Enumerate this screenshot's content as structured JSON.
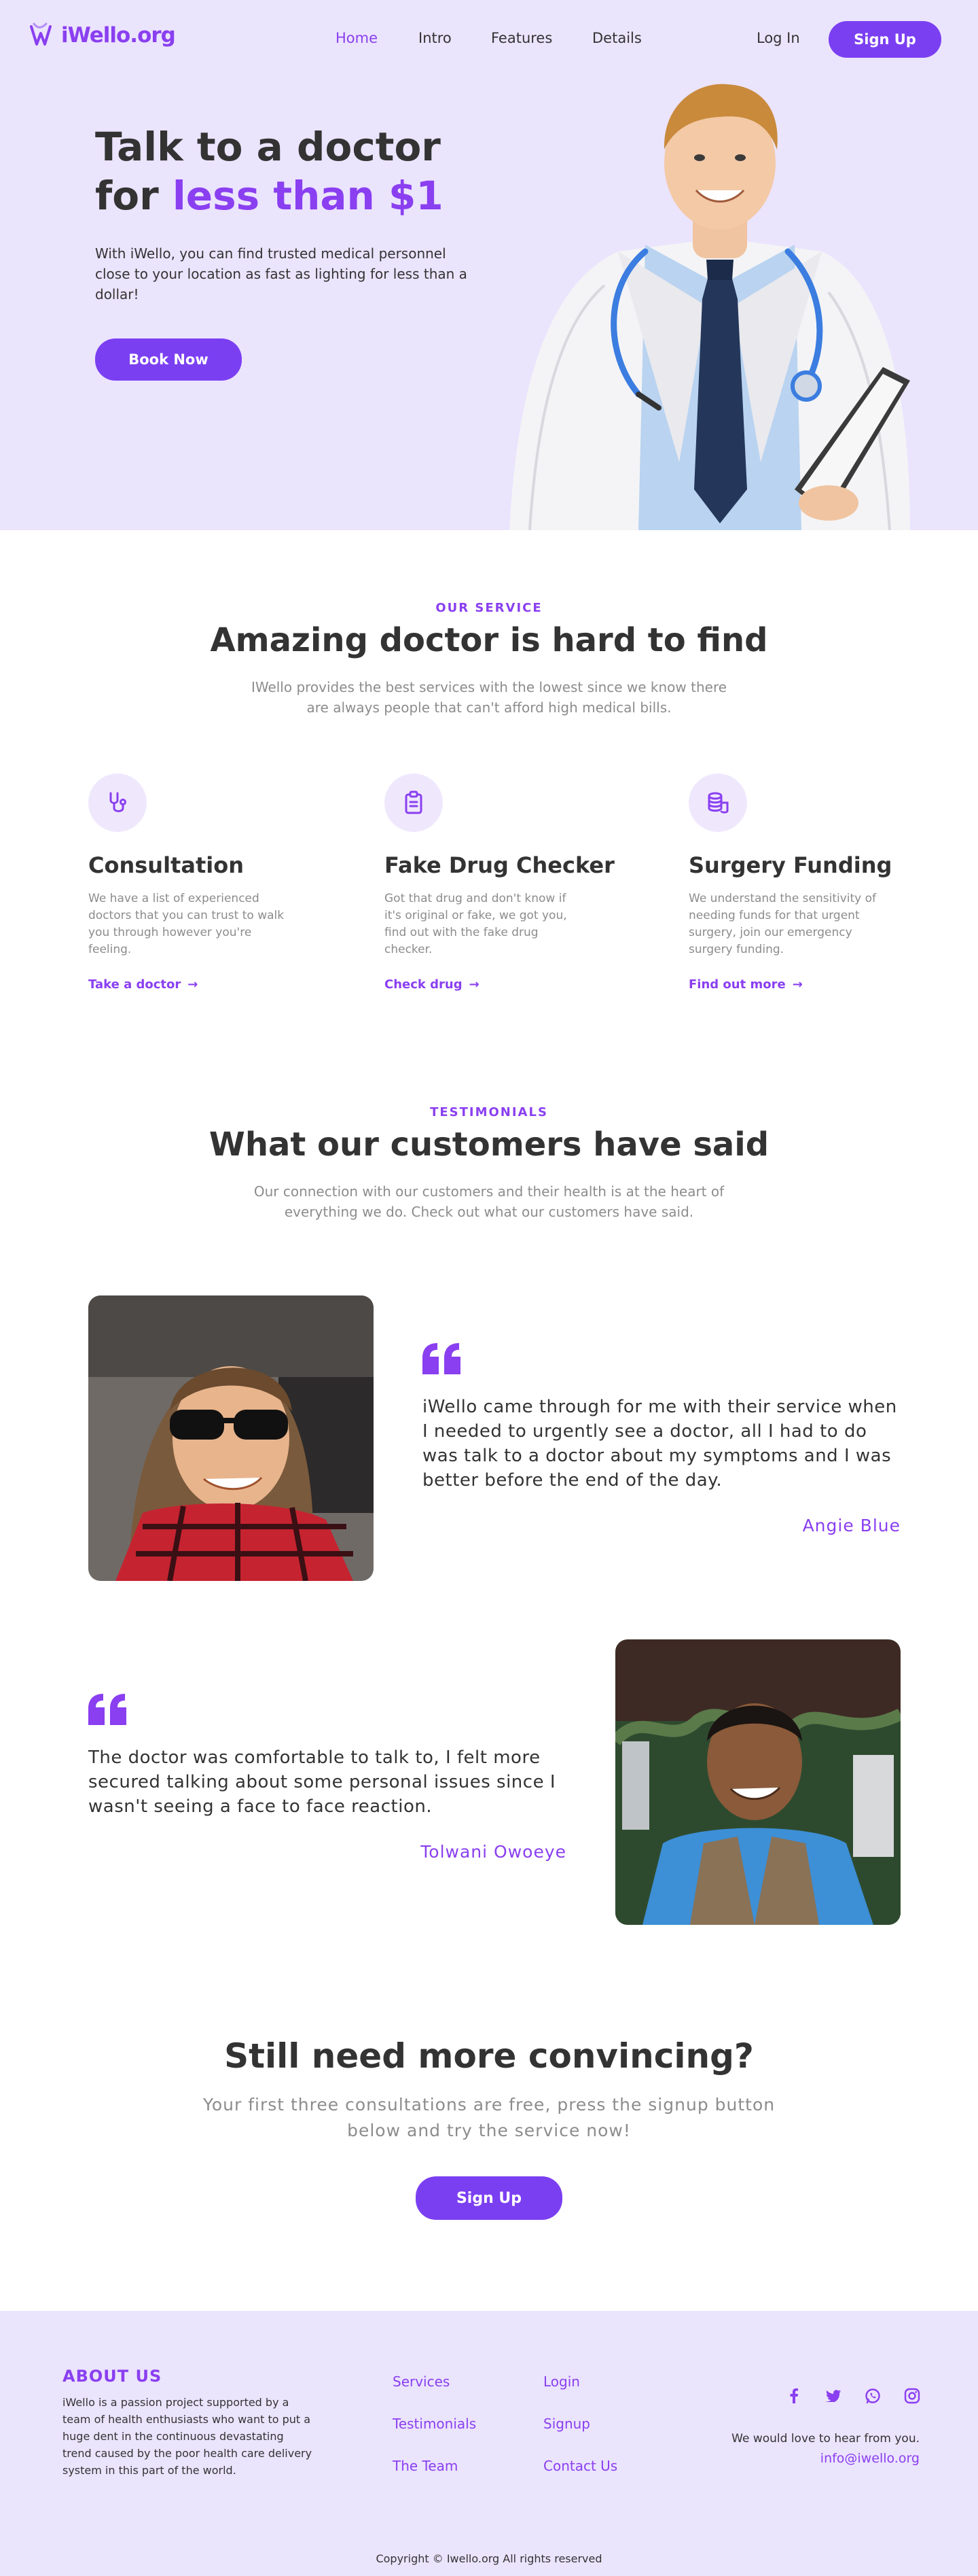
{
  "brand": {
    "logo_text": "iWello.org",
    "accent": "#8a3ff0",
    "button_color": "#7b3ff2",
    "tint": "#ebe4fd"
  },
  "nav": {
    "items": [
      {
        "label": "Home",
        "active": true
      },
      {
        "label": "Intro"
      },
      {
        "label": "Features"
      },
      {
        "label": "Details"
      }
    ],
    "login": "Log In",
    "signup": "Sign Up"
  },
  "hero": {
    "title_line1": "Talk to a doctor",
    "title_line2_prefix": "for ",
    "title_line2_accent": "less than $1",
    "text": "With iWello, you can find trusted medical personnel close to your location as fast as lighting for less than a dollar!",
    "cta": "Book Now"
  },
  "service": {
    "eyebrow": "OUR SERVICE",
    "title": "Amazing doctor is hard to find",
    "subtitle": "IWello provides the best services with the lowest since we know there are always people that can't afford high medical bills.",
    "items": [
      {
        "icon": "stethoscope-icon",
        "title": "Consultation",
        "text": "We have a list of experienced doctors that you can trust to walk you through however you're feeling.",
        "link": "Take a doctor"
      },
      {
        "icon": "clipboard-icon",
        "title": "Fake Drug Checker",
        "text": "Got that drug and don't know if it's original or fake, we got you, find out with the fake drug checker.",
        "link": "Check drug"
      },
      {
        "icon": "coins-icon",
        "title": "Surgery Funding",
        "text": "We understand the sensitivity of needing funds for that urgent surgery, join our emergency surgery funding.",
        "link": "Find out more"
      }
    ]
  },
  "testimonials": {
    "eyebrow": "TESTIMONIALS",
    "title": "What our customers have said",
    "subtitle": "Our connection with our customers and their health is at the heart of everything we do. Check out what our customers have said.",
    "items": [
      {
        "quote": "iWello came through for me with their service when I needed to urgently see a doctor, all I had to do was talk to a doctor about my symptoms and I was better before the end of the day.",
        "author": "Angie Blue"
      },
      {
        "quote": "The doctor was comfortable to talk to, I felt more secured talking about some personal issues since I wasn't seeing a face to face reaction.",
        "author": "Tolwani Owoeye"
      }
    ]
  },
  "cta": {
    "title": "Still need more convincing?",
    "subtitle": "Your first three consultations are free, press the signup button below and try the service now!",
    "button": "Sign Up"
  },
  "footer": {
    "about_title": "ABOUT US",
    "about_text": "iWello is a passion project supported by a team of health enthusiasts who want to put a huge dent in the continuous devastating trend caused by the poor health care delivery system in this part of the world.",
    "col1": [
      "Services",
      "Testimonials",
      "The Team"
    ],
    "col2": [
      "Login",
      "Signup",
      "Contact Us"
    ],
    "social": [
      "facebook-icon",
      "twitter-icon",
      "whatsapp-icon",
      "instagram-icon"
    ],
    "hear": "We would love to hear from you.",
    "email": "info@iwello.org",
    "copyright": "Copyright © Iwello.org All rights reserved"
  }
}
